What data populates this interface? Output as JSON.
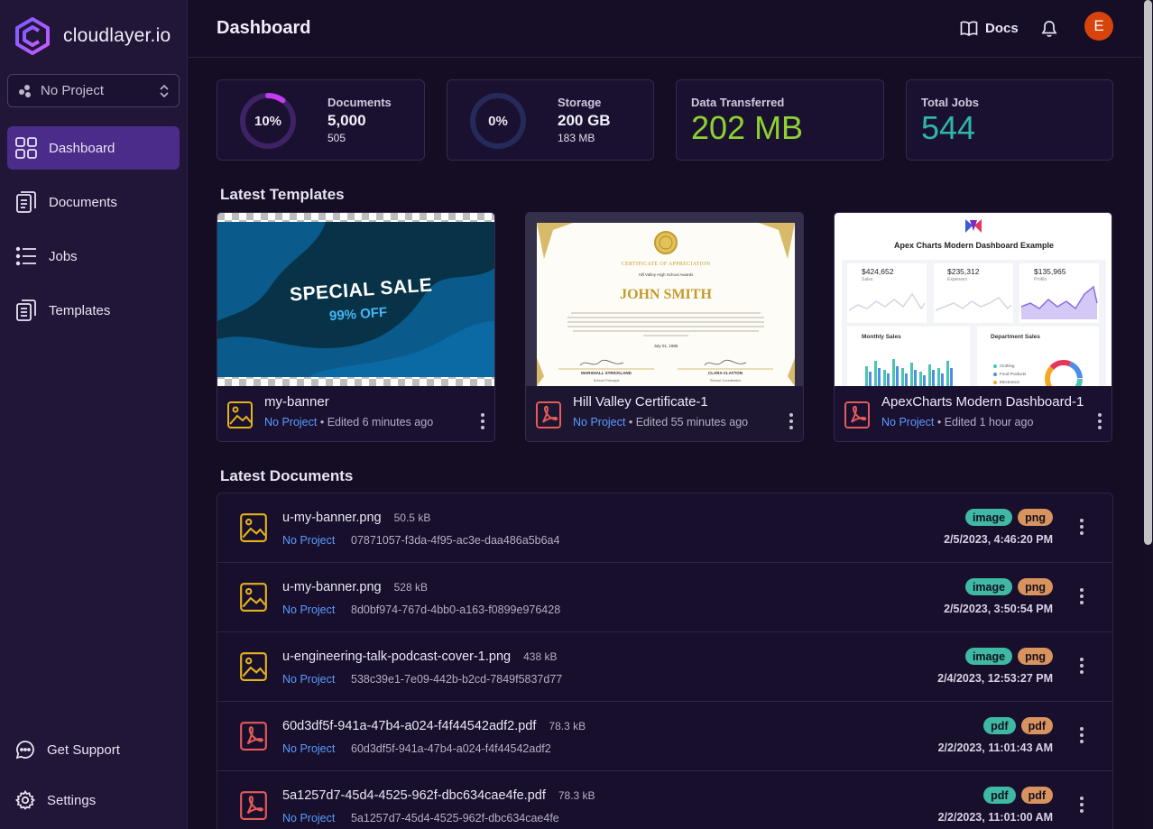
{
  "app": {
    "brand": "cloudlayer.io"
  },
  "sidebar": {
    "project_select": "No Project",
    "items": [
      {
        "label": "Dashboard",
        "icon": "grid-icon",
        "active": true
      },
      {
        "label": "Documents",
        "icon": "documents-icon"
      },
      {
        "label": "Jobs",
        "icon": "list-icon"
      },
      {
        "label": "Templates",
        "icon": "templates-icon"
      }
    ],
    "bottom": [
      {
        "label": "Get Support",
        "icon": "chat-icon"
      },
      {
        "label": "Settings",
        "icon": "gear-icon"
      }
    ]
  },
  "header": {
    "title": "Dashboard",
    "docs_label": "Docs",
    "avatar_initial": "E"
  },
  "stats": {
    "documents": {
      "percent_label": "10%",
      "percent": 0.1,
      "label": "Documents",
      "value": "5,000",
      "sub": "505"
    },
    "storage": {
      "percent_label": "0%",
      "percent": 0,
      "label": "Storage",
      "value": "200 GB",
      "sub": "183 MB"
    },
    "transfer": {
      "label": "Data Transferred",
      "value": "202 MB",
      "color": "#8fd130"
    },
    "jobs": {
      "label": "Total Jobs",
      "value": "544",
      "color": "#2fb6a6"
    }
  },
  "templates_section": {
    "title": "Latest Templates",
    "items": [
      {
        "name": "my-banner",
        "project": "No Project",
        "edited": "Edited 6 minutes ago",
        "type": "image",
        "preview": {
          "headline": "SPECIAL SALE",
          "sub": "99% OFF"
        }
      },
      {
        "name": "Hill Valley Certificate-1",
        "project": "No Project",
        "edited": "Edited 55 minutes ago",
        "type": "pdf",
        "preview": {
          "title": "CERTIFICATE OF APPRECIATION",
          "subtitle": "Hill Valley High School Awards",
          "name": "JOHN SMITH",
          "date": "July 01, 1985",
          "sig_left_name": "MARSHALL STRICKLAND",
          "sig_left_role": "School Principal",
          "sig_right_name": "CLARA CLAYTON",
          "sig_right_role": "School Coordinator"
        }
      },
      {
        "name": "ApexCharts Modern Dashboard-1",
        "project": "No Project",
        "edited": "Edited 1 hour ago",
        "type": "pdf",
        "preview": {
          "title": "Apex Charts Modern Dashboard Example",
          "kpis": [
            {
              "value": "$424,652",
              "label": "Sales"
            },
            {
              "value": "$235,312",
              "label": "Expenses"
            },
            {
              "value": "$135,965",
              "label": "Profits"
            }
          ],
          "monthly": "Monthly Sales",
          "department": "Department Sales",
          "legend": [
            "Clothing",
            "Food Products",
            "Electronics"
          ]
        }
      }
    ]
  },
  "documents_section": {
    "title": "Latest Documents",
    "rows": [
      {
        "name": "u-my-banner.png",
        "size": "50.5 kB",
        "project": "No Project",
        "id": "07871057-f3da-4f95-ac3e-daa486a5b6a4",
        "badges": [
          "image",
          "png"
        ],
        "date": "2/5/2023, 4:46:20 PM",
        "type": "image"
      },
      {
        "name": "u-my-banner.png",
        "size": "528 kB",
        "project": "No Project",
        "id": "8d0bf974-767d-4bb0-a163-f0899e976428",
        "badges": [
          "image",
          "png"
        ],
        "date": "2/5/2023, 3:50:54 PM",
        "type": "image"
      },
      {
        "name": "u-engineering-talk-podcast-cover-1.png",
        "size": "438 kB",
        "project": "No Project",
        "id": "538c39e1-7e09-442b-b2cd-7849f5837d77",
        "badges": [
          "image",
          "png"
        ],
        "date": "2/4/2023, 12:53:27 PM",
        "type": "image"
      },
      {
        "name": "60d3df5f-941a-47b4-a024-f4f44542adf2.pdf",
        "size": "78.3 kB",
        "project": "No Project",
        "id": "60d3df5f-941a-47b4-a024-f4f44542adf2",
        "badges": [
          "pdf",
          "pdf"
        ],
        "date": "2/2/2023, 11:01:43 AM",
        "type": "pdf"
      },
      {
        "name": "5a1257d7-45d4-4525-962f-dbc634cae4fe.pdf",
        "size": "78.3 kB",
        "project": "No Project",
        "id": "5a1257d7-45d4-4525-962f-dbc634cae4fe",
        "badges": [
          "pdf",
          "pdf"
        ],
        "date": "2/2/2023, 11:01:00 AM",
        "type": "pdf"
      }
    ]
  }
}
